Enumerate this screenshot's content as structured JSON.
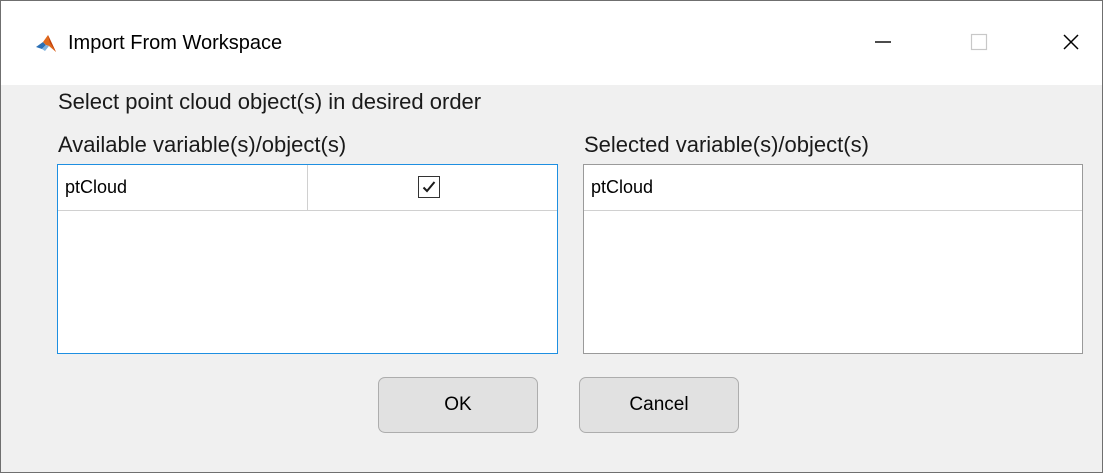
{
  "window": {
    "title": "Import From Workspace",
    "app_icon": "matlab-icon",
    "controls": {
      "minimize_icon": "minimize-icon",
      "maximize_icon": "maximize-icon",
      "close_icon": "close-icon"
    }
  },
  "dialog": {
    "instruction": "Select point cloud object(s) in desired order",
    "available_label": "Available variable(s)/object(s)",
    "selected_label": "Selected variable(s)/object(s)",
    "available_rows": [
      {
        "name": "ptCloud",
        "checked": true
      }
    ],
    "selected_rows": [
      {
        "name": "ptCloud"
      }
    ]
  },
  "buttons": {
    "ok_label": "OK",
    "cancel_label": "Cancel"
  },
  "colors": {
    "focus_border": "#1e8fe1",
    "dialog_bg": "#f0f0f0"
  }
}
